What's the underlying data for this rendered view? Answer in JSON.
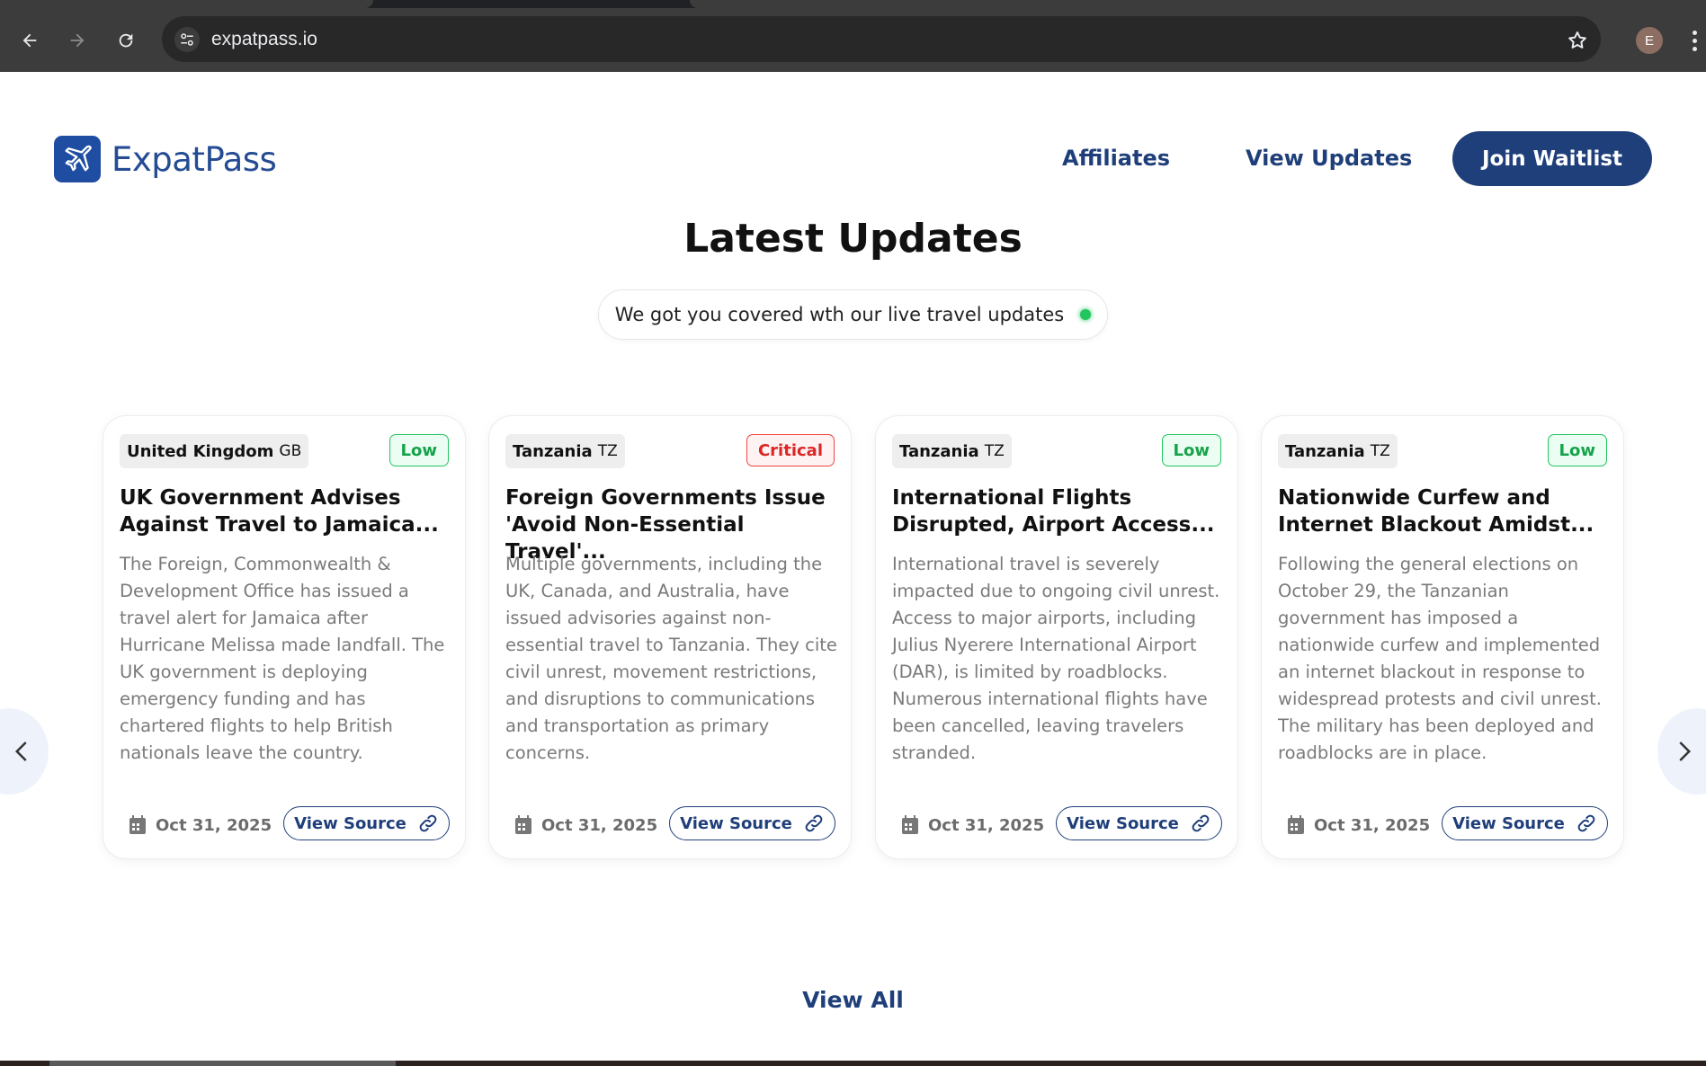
{
  "browser": {
    "url": "expatpass.io",
    "profile_initial": "E"
  },
  "header": {
    "logo_text": "ExpatPass",
    "nav": {
      "affiliates": "Affiliates",
      "view_updates": "View Updates",
      "join_waitlist": "Join Waitlist"
    }
  },
  "main": {
    "heading": "Latest Updates",
    "subtitle": "We got you covered wth our live travel updates",
    "view_all": "View All",
    "cards": [
      {
        "country": "United Kingdom",
        "code": "GB",
        "severity": "Low",
        "title": "UK Government Advises Against Travel to Jamaica...",
        "body": "The Foreign, Commonwealth & Development Office has issued a travel alert for Jamaica after Hurricane Melissa made landfall. The UK government is deploying emergency funding and has chartered flights to help British nationals leave the country.",
        "date": "Oct 31, 2025",
        "source_label": "View Source"
      },
      {
        "country": "Tanzania",
        "code": "TZ",
        "severity": "Critical",
        "title": "Foreign Governments Issue 'Avoid Non-Essential Travel'...",
        "body": "Multiple governments, including the UK, Canada, and Australia, have issued advisories against non-essential travel to Tanzania. They cite civil unrest, movement restrictions, and disruptions to communications and transportation as primary concerns.",
        "date": "Oct 31, 2025",
        "source_label": "View Source"
      },
      {
        "country": "Tanzania",
        "code": "TZ",
        "severity": "Low",
        "title": "International Flights Disrupted, Airport Access...",
        "body": "International travel is severely impacted due to ongoing civil unrest. Access to major airports, including Julius Nyerere International Airport (DAR), is limited by roadblocks. Numerous international flights have been cancelled, leaving travelers stranded.",
        "date": "Oct 31, 2025",
        "source_label": "View Source"
      },
      {
        "country": "Tanzania",
        "code": "TZ",
        "severity": "Low",
        "title": "Nationwide Curfew and Internet Blackout Amidst...",
        "body": "Following the general elections on October 29, the Tanzanian government has imposed a nationwide curfew and implemented an internet blackout in response to widespread protests and civil unrest. The military has been deployed and roadblocks are in place.",
        "date": "Oct 31, 2025",
        "source_label": "View Source"
      }
    ]
  },
  "colors": {
    "brand": "#1f3f7a",
    "low": "#16a34a",
    "critical": "#dc2626",
    "live": "#22c55e"
  },
  "icons": [
    "back-icon",
    "forward-icon",
    "reload-icon",
    "site-settings-icon",
    "bookmark-star-icon",
    "more-menu-icon",
    "plane-logo-icon",
    "calendar-icon",
    "link-icon",
    "chevron-left-icon",
    "chevron-right-icon"
  ]
}
